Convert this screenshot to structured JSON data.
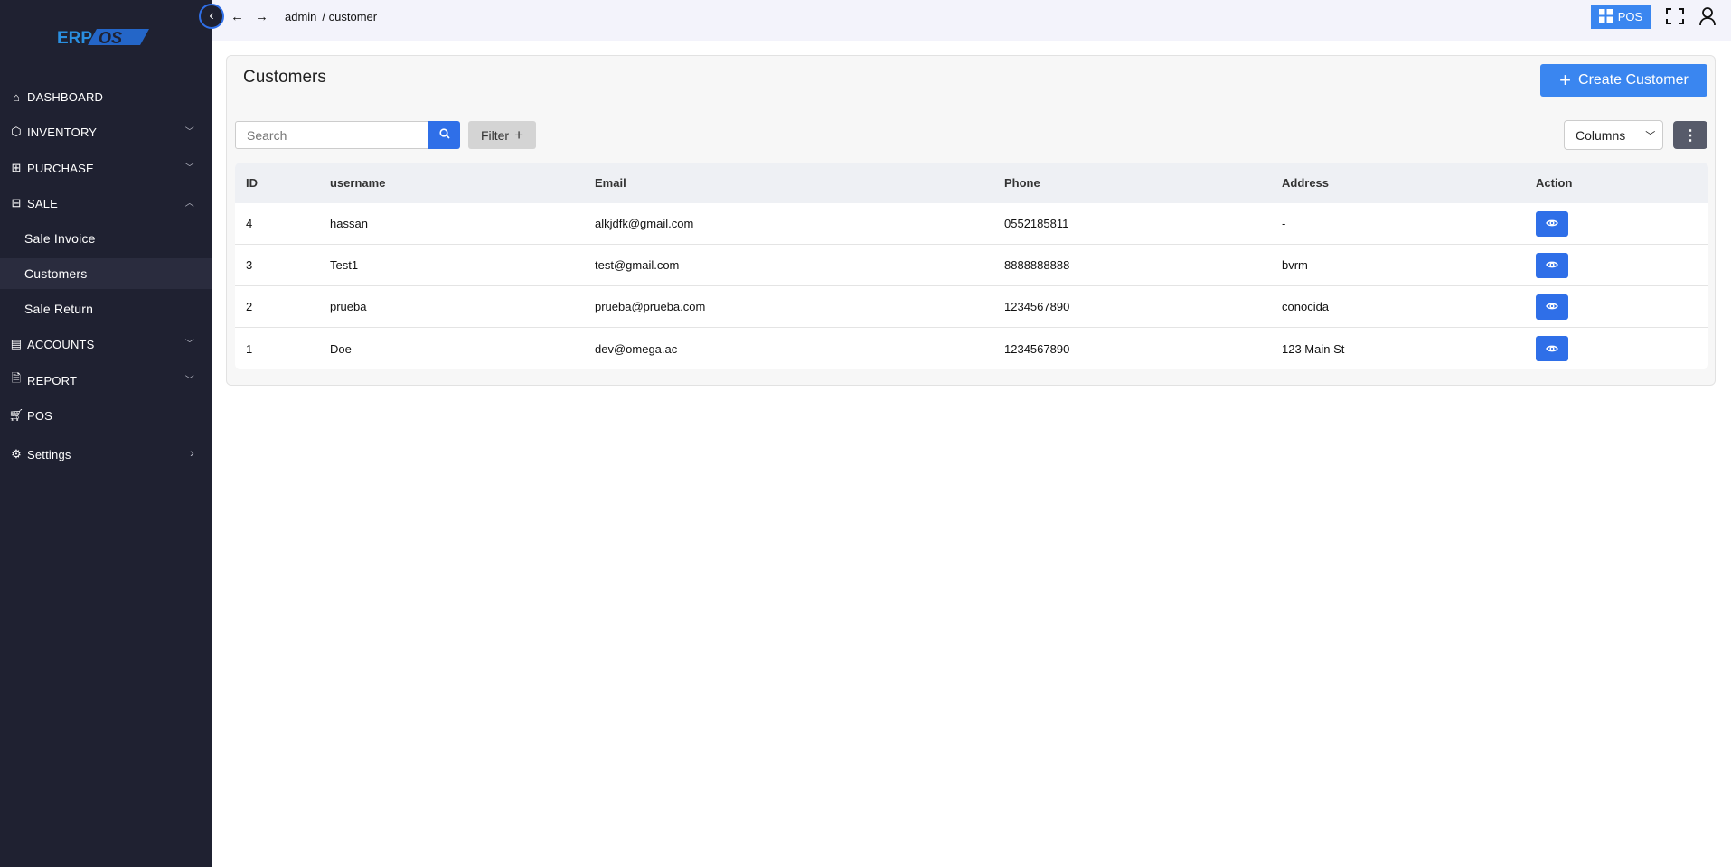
{
  "logo": {
    "text": "ERP OS"
  },
  "sidebar": {
    "items": [
      {
        "label": "DASHBOARD",
        "icon": "home-icon"
      },
      {
        "label": "INVENTORY",
        "icon": "cube-icon"
      },
      {
        "label": "PURCHASE",
        "icon": "plus-square-icon"
      },
      {
        "label": "SALE",
        "icon": "minus-square-icon"
      },
      {
        "label": "Sale Invoice"
      },
      {
        "label": "Customers"
      },
      {
        "label": "Sale Return"
      },
      {
        "label": "ACCOUNTS",
        "icon": "ledger-icon"
      },
      {
        "label": "REPORT",
        "icon": "file-icon"
      },
      {
        "label": "POS",
        "icon": "cart-icon"
      },
      {
        "label": "Settings",
        "icon": "gear-icon"
      }
    ]
  },
  "topbar": {
    "breadcrumb": [
      "admin",
      "/ customer"
    ],
    "pos_label": "POS"
  },
  "page": {
    "title": "Customers",
    "create_label": "Create Customer",
    "search_placeholder": "Search",
    "filter_label": "Filter",
    "columns_label": "Columns"
  },
  "table": {
    "headers": [
      "ID",
      "username",
      "Email",
      "Phone",
      "Address",
      "Action"
    ],
    "rows": [
      [
        "4",
        "hassan",
        "alkjdfk@gmail.com",
        "0552185811",
        "-"
      ],
      [
        "3",
        "Test1",
        "test@gmail.com",
        "8888888888",
        "bvrm"
      ],
      [
        "2",
        "prueba",
        "prueba@prueba.com",
        "1234567890",
        "conocida"
      ],
      [
        "1",
        "Doe",
        "dev@omega.ac",
        "1234567890",
        "123 Main St"
      ]
    ]
  },
  "colors": {
    "sidebar": "#1f2131",
    "primary": "#2f6fe8",
    "create": "#3a86f0"
  }
}
